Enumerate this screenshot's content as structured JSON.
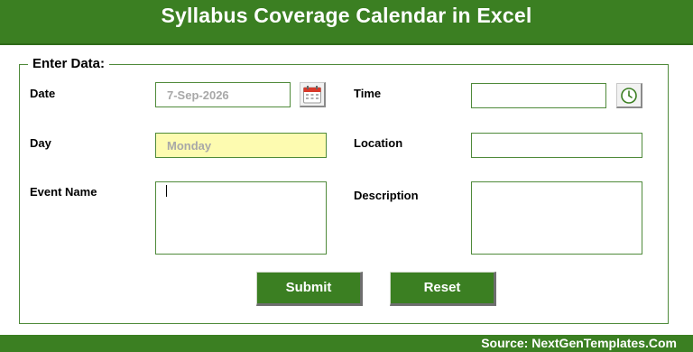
{
  "header": {
    "title": "Syllabus Coverage Calendar in Excel"
  },
  "form": {
    "legend": "Enter Data:",
    "labels": {
      "date": "Date",
      "time": "Time",
      "day": "Day",
      "location": "Location",
      "event_name": "Event Name",
      "description": "Description"
    },
    "values": {
      "date": "7-Sep-2026",
      "time": "",
      "day": "Monday",
      "location": "",
      "event_name": "",
      "description": ""
    },
    "icons": {
      "date_picker": "calendar-icon",
      "time_picker": "clock-icon"
    }
  },
  "buttons": {
    "submit": "Submit",
    "reset": "Reset"
  },
  "footer": {
    "source": "Source: NextGenTemplates.Com"
  },
  "colors": {
    "brand_green": "#3b7f22",
    "day_field_bg": "#fdfbb0",
    "field_border": "#4f8a3a"
  }
}
